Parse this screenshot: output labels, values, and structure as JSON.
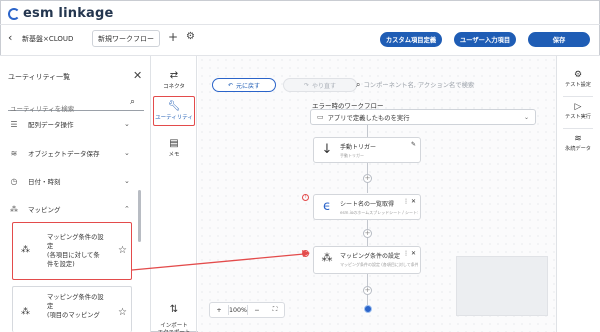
{
  "header": {
    "logo_text": "esm linkage",
    "back_icon": "chevron-left-icon",
    "breadcrumb": "新基盤×CLOUD",
    "workflow_tab": "新規ワークフロー",
    "add_icon": "plus-icon",
    "settings_icon": "gear-icon",
    "buttons": {
      "custom_fields": "カスタム項目定義",
      "user_input": "ユーザー入力項目",
      "save": "保存"
    }
  },
  "utility_panel": {
    "title": "ユーティリティ一覧",
    "search_placeholder": "ユーティリティを検索",
    "categories": [
      {
        "label": "配列データ操作",
        "icon": "list-icon",
        "expanded": false
      },
      {
        "label": "オブジェクトデータ保存",
        "icon": "database-icon",
        "expanded": false
      },
      {
        "label": "日付・時刻",
        "icon": "clock-icon",
        "expanded": false
      },
      {
        "label": "マッピング",
        "icon": "mapping-icon",
        "expanded": true
      }
    ],
    "items": [
      {
        "lines": [
          "マッピング条件の設",
          "定",
          "(各項目に対して条",
          "件を設定)"
        ],
        "icon": "mapping-icon",
        "star_icon": "star-icon",
        "highlighted": true
      },
      {
        "lines": [
          "マッピング条件の設",
          "定",
          "(項目のマッピング"
        ],
        "icon": "mapping-icon",
        "star_icon": "star-icon",
        "highlighted": false
      }
    ]
  },
  "tool_rail": {
    "items": [
      {
        "label": "コネクタ",
        "icon": "swap-arrows-icon",
        "selected": false
      },
      {
        "label": "ユーティリティ",
        "icon": "wrench-icon",
        "selected": true
      },
      {
        "label": "メモ",
        "icon": "memo-icon",
        "selected": false
      },
      {
        "label": "インポート\nエクスポート",
        "icon": "import-export-icon",
        "selected": false
      }
    ]
  },
  "canvas": {
    "undo_label": "元に戻す",
    "redo_label": "やり直す",
    "search_placeholder": "コンポーネント名, アクション名で検索",
    "flow_title": "エラー時のワークフロー",
    "select_value": "アプリで定義したものを実行",
    "nodes": [
      {
        "title": "手動トリガー",
        "subtitle": "手動トリガー",
        "icon": "arrow-down-icon",
        "right_icon": "edit-icon"
      },
      {
        "title": "シート名の一覧取得",
        "subtitle": "esm.ioのホームスプレッドシート / シート名の一覧取得",
        "icon": "esm-logo-icon",
        "right_icon": "more-close-icon"
      },
      {
        "title": "マッピング条件の設定",
        "subtitle": "マッピング条件の設定 (各項目に対して条件...",
        "icon": "mapping-icon",
        "right_icon": "more-close-icon"
      }
    ],
    "zoom_level": "100%",
    "zoom_in": "+",
    "zoom_out": "−"
  },
  "right_rail": {
    "items": [
      {
        "label": "テスト設定",
        "icon": "gear-icon"
      },
      {
        "label": "テスト実行",
        "icon": "play-icon"
      },
      {
        "label": "永続データ",
        "icon": "database-icon"
      }
    ]
  },
  "colors": {
    "accent": "#1f5db5",
    "highlight": "#e34b4b",
    "border": "#d6d9de"
  }
}
